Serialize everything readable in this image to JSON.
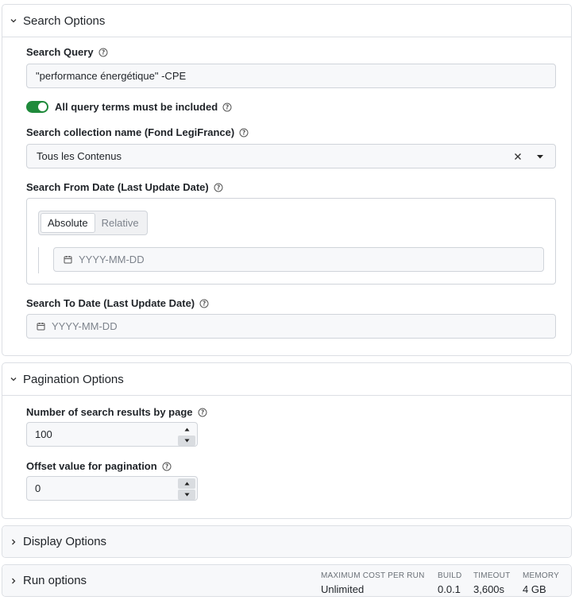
{
  "search_options": {
    "title": "Search Options",
    "query": {
      "label": "Search Query",
      "value": "\"performance énergétique\" -CPE"
    },
    "all_terms": {
      "label": "All query terms must be included",
      "enabled": true
    },
    "collection": {
      "label": "Search collection name (Fond LegiFrance)",
      "value": "Tous les Contenus"
    },
    "from_date": {
      "label": "Search From Date (Last Update Date)",
      "tabs": [
        "Absolute",
        "Relative"
      ],
      "active_tab": "Absolute",
      "placeholder": "YYYY-MM-DD"
    },
    "to_date": {
      "label": "Search To Date (Last Update Date)",
      "placeholder": "YYYY-MM-DD"
    }
  },
  "pagination_options": {
    "title": "Pagination Options",
    "results_per_page": {
      "label": "Number of search results by page",
      "value": "100"
    },
    "offset": {
      "label": "Offset value for pagination",
      "value": "0"
    }
  },
  "display_options": {
    "title": "Display Options"
  },
  "run_options": {
    "title": "Run options",
    "stats": [
      {
        "head": "MAXIMUM COST PER RUN",
        "value": "Unlimited"
      },
      {
        "head": "BUILD",
        "value": "0.0.1"
      },
      {
        "head": "TIMEOUT",
        "value": "3,600s"
      },
      {
        "head": "MEMORY",
        "value": "4 GB"
      }
    ]
  },
  "colors": {
    "toggle_on": "#1f8a3b",
    "border": "#dcdfe4",
    "field_bg": "#f7f8fa"
  }
}
